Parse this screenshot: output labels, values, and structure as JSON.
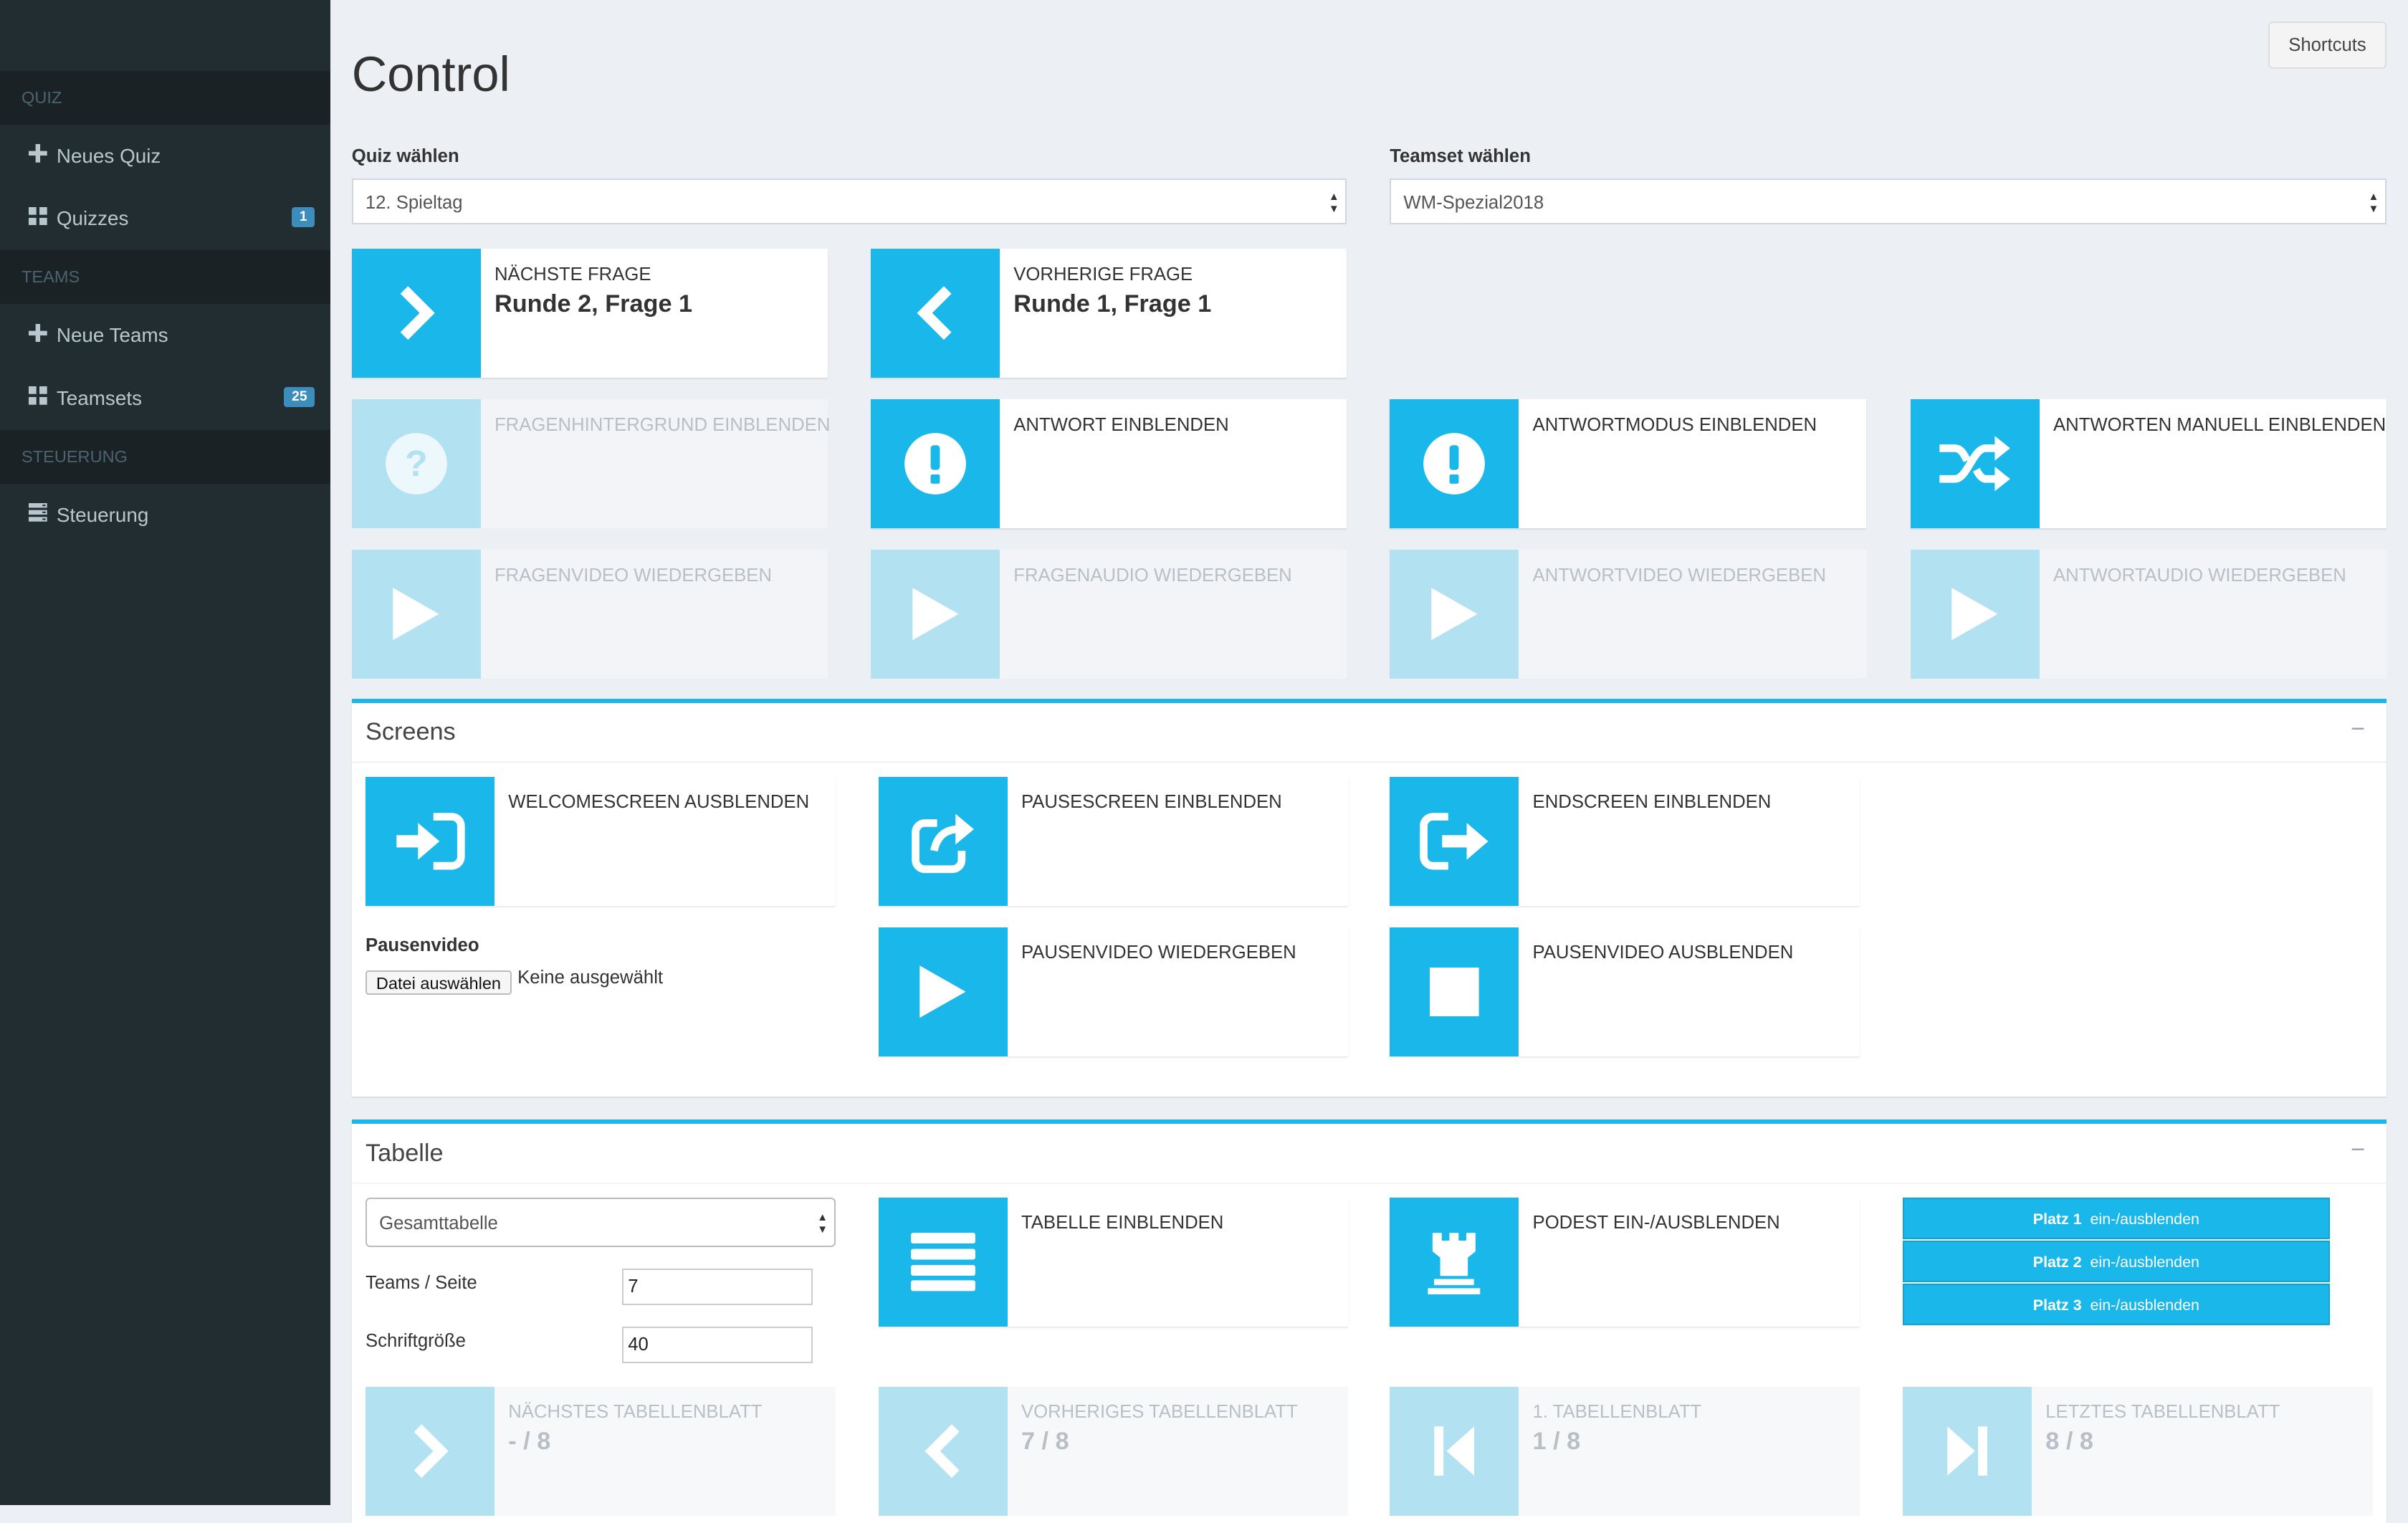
{
  "sidebar": {
    "sections": [
      {
        "header": "Quiz",
        "items": [
          {
            "label": "Neues Quiz",
            "icon": "plus-icon"
          },
          {
            "label": "Quizzes",
            "icon": "grid-icon",
            "badge": "1"
          }
        ]
      },
      {
        "header": "Teams",
        "items": [
          {
            "label": "Neue Teams",
            "icon": "plus-icon"
          },
          {
            "label": "Teamsets",
            "icon": "grid-icon",
            "badge": "25"
          }
        ]
      },
      {
        "header": "Steuerung",
        "items": [
          {
            "label": "Steuerung",
            "icon": "server-icon"
          }
        ]
      }
    ]
  },
  "header": {
    "title": "Control",
    "shortcuts_label": "Shortcuts"
  },
  "quiz_select": {
    "label": "Quiz wählen",
    "value": "12. Spieltag"
  },
  "teamset_select": {
    "label": "Teamset wählen",
    "value": "WM-Spezial2018"
  },
  "navigation": {
    "next": {
      "label": "Nächste Frage",
      "value": "Runde 2, Frage 1"
    },
    "prev": {
      "label": "Vorherige Frage",
      "value": "Runde 1, Frage 1"
    }
  },
  "actions": {
    "fragenhintergrund": "Fragenhintergrund  einblenden",
    "antwort": "Antwort  einblenden",
    "antwortmodus": "Antwortmodus  einblenden",
    "antworten_manuell": "Antworten manuell einblenden",
    "fragenvideo": "Fragenvideo  wiedergeben",
    "fragenaudio": "Fragenaudio  wiedergeben",
    "antwortvideo": "Antwortvideo  wiedergeben",
    "antwortaudio": "Antwortaudio  wiedergeben"
  },
  "screens": {
    "title": "Screens",
    "collapse": "−",
    "welcome": "Welcomescreen  ausblenden",
    "pause": "Pausescreen  einblenden",
    "end": "Endscreen  einblenden",
    "pausenvideo_label": "Pausenvideo",
    "file_button": "Datei auswählen",
    "file_status": "Keine ausgewählt",
    "pausenvideo_play": "Pausenvideo  wiedergeben",
    "pausenvideo_hide": "Pausenvideo  ausblenden"
  },
  "tabelle": {
    "title": "Tabelle",
    "collapse": "−",
    "select_value": "Gesamttabelle",
    "teams_per_page_label": "Teams / Seite",
    "teams_per_page_value": "7",
    "font_size_label": "Schriftgröße",
    "font_size_value": "40",
    "show_table": "Tabelle  einblenden",
    "podest": "Podest ein-/ausblenden",
    "platz": [
      {
        "name": "Platz 1",
        "action": "ein-/ausblenden"
      },
      {
        "name": "Platz 2",
        "action": "ein-/ausblenden"
      },
      {
        "name": "Platz 3",
        "action": "ein-/ausblenden"
      }
    ],
    "next_sheet": {
      "label": "Nächstes Tabellenblatt",
      "value": "- / 8"
    },
    "prev_sheet": {
      "label": "Vorheriges Tabellenblatt",
      "value": "7 / 8"
    },
    "first_sheet": {
      "label": "1. Tabellenblatt",
      "value": "1 /  8"
    },
    "last_sheet": {
      "label": "Letztes Tabellenblatt",
      "value": "8 / 8"
    }
  },
  "colors": {
    "accent": "#1ab7ea",
    "sidebar": "#222d32",
    "background": "#ecf0f5"
  }
}
